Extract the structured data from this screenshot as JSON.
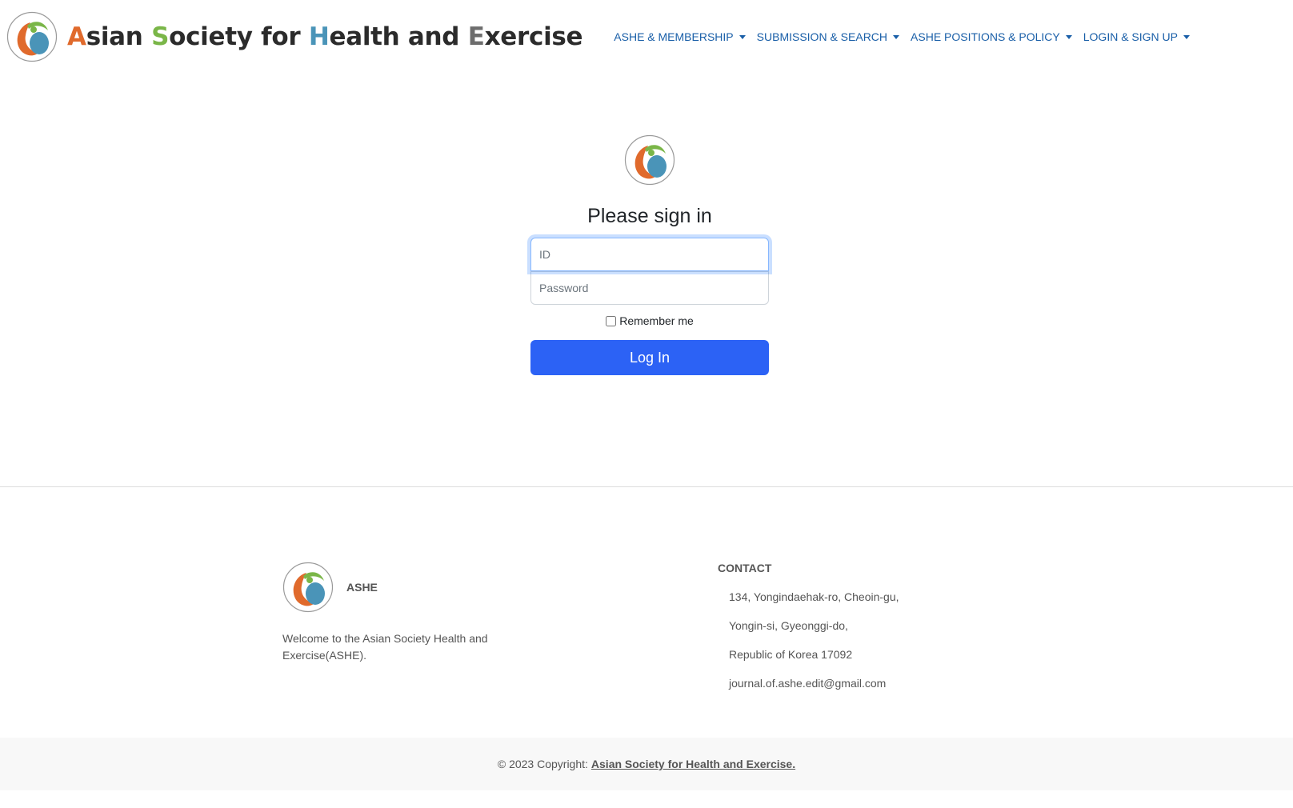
{
  "brand": {
    "parts": [
      {
        "text": "A",
        "color": "#e06a2c"
      },
      {
        "text": "sian ",
        "color": "#2b2b2b"
      },
      {
        "text": "S",
        "color": "#7ab648"
      },
      {
        "text": "ociety for ",
        "color": "#2b2b2b"
      },
      {
        "text": "H",
        "color": "#4a94b8"
      },
      {
        "text": "ealth and ",
        "color": "#2b2b2b"
      },
      {
        "text": "E",
        "color": "#6d6d6d"
      },
      {
        "text": "xercise",
        "color": "#2b2b2b"
      }
    ]
  },
  "nav": {
    "items": [
      {
        "label": "ASHE & MEMBERSHIP"
      },
      {
        "label": "SUBMISSION & SEARCH"
      },
      {
        "label": "ASHE POSITIONS & POLICY"
      },
      {
        "label": "LOGIN & SIGN UP"
      }
    ]
  },
  "signin": {
    "title": "Please sign in",
    "id_placeholder": "ID",
    "password_placeholder": "Password",
    "remember_label": "Remember me",
    "button_label": "Log In"
  },
  "footer": {
    "brand_name": "ASHE",
    "welcome": "Welcome to the Asian Society Health and Exercise(ASHE).",
    "contact_title": "CONTACT",
    "contact_lines": [
      "134, Yongindaehak-ro, Cheoin-gu,",
      "Yongin-si, Gyeonggi-do,",
      "Republic of Korea 17092",
      "journal.of.ashe.edit@gmail.com"
    ],
    "copyright_prefix": "© 2023 Copyright:",
    "copyright_link": "Asian Society for Health and Exercise."
  },
  "colors": {
    "logo_orange": "#e06a2c",
    "logo_blue": "#4a94b8",
    "logo_green": "#7ab648",
    "nav_link": "#1a5fa8",
    "button": "#2c62f5"
  }
}
